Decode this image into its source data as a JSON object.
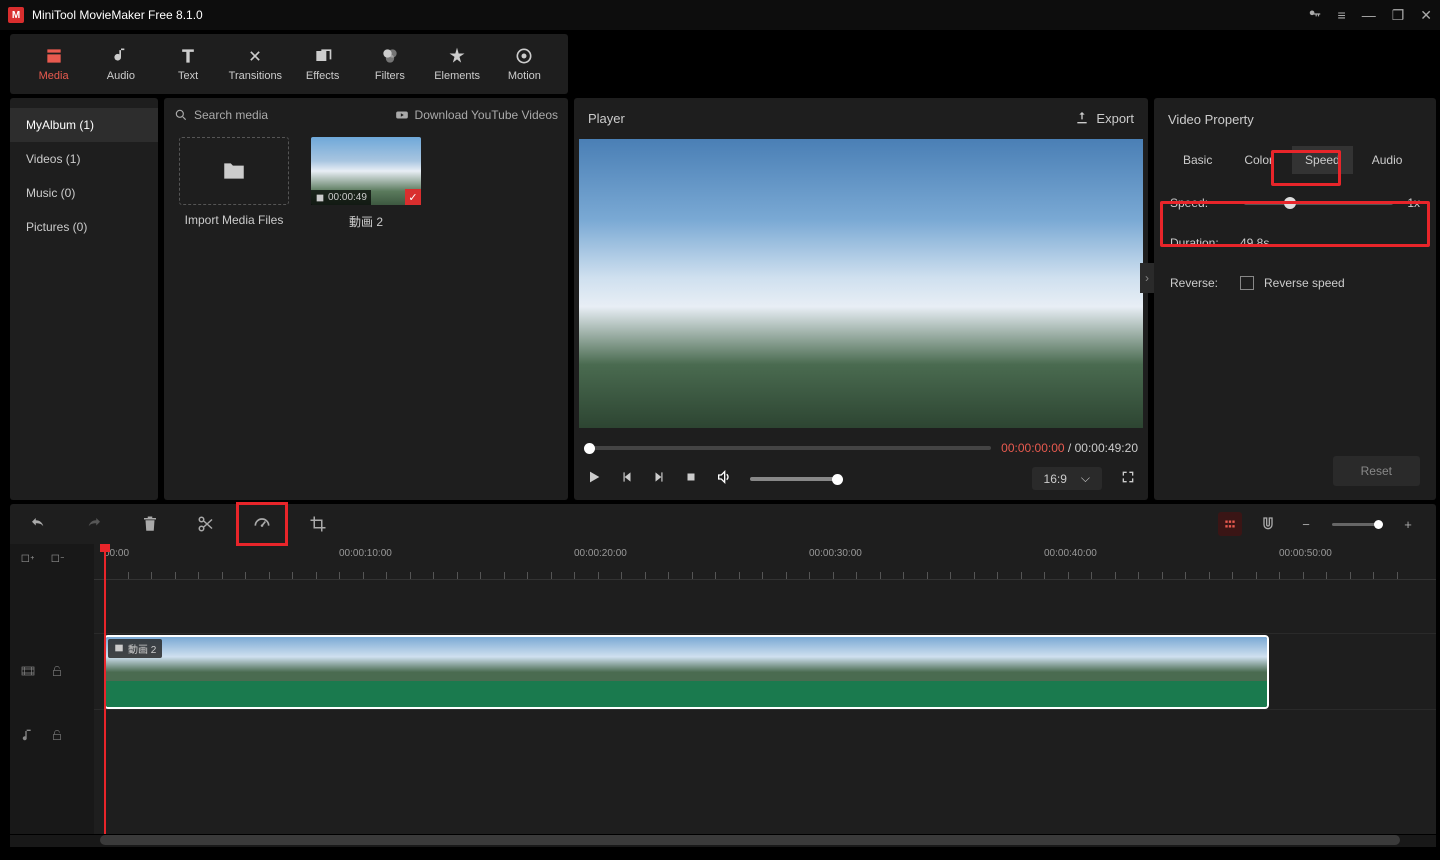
{
  "titlebar": {
    "title": "MiniTool MovieMaker Free 8.1.0"
  },
  "tools": [
    {
      "label": "Media",
      "active": true
    },
    {
      "label": "Audio"
    },
    {
      "label": "Text"
    },
    {
      "label": "Transitions"
    },
    {
      "label": "Effects"
    },
    {
      "label": "Filters"
    },
    {
      "label": "Elements"
    },
    {
      "label": "Motion"
    }
  ],
  "sidebar": {
    "items": [
      {
        "label": "MyAlbum (1)",
        "active": true
      },
      {
        "label": "Videos (1)"
      },
      {
        "label": "Music (0)"
      },
      {
        "label": "Pictures (0)"
      }
    ]
  },
  "media": {
    "searchPlaceholder": "Search media",
    "downloadYT": "Download YouTube Videos",
    "importLabel": "Import Media Files",
    "clip": {
      "name": "動画 2",
      "duration": "00:00:49"
    }
  },
  "player": {
    "title": "Player",
    "exportLabel": "Export",
    "currentTime": "00:00:00:00",
    "totalTime": "00:00:49:20",
    "aspect": "16:9"
  },
  "props": {
    "title": "Video Property",
    "tabs": [
      "Basic",
      "Color",
      "Speed",
      "Audio"
    ],
    "activeTab": "Speed",
    "speedLabel": "Speed:",
    "speedValue": "1x",
    "durationLabel": "Duration:",
    "durationValue": "49.8s",
    "reverseLabel": "Reverse:",
    "reverseCheck": "Reverse speed",
    "resetLabel": "Reset"
  },
  "timeline": {
    "ticks": [
      "00:00",
      "00:00:10:00",
      "00:00:20:00",
      "00:00:30:00",
      "00:00:40:00",
      "00:00:50:00"
    ],
    "clipLabel": "動画 2"
  }
}
